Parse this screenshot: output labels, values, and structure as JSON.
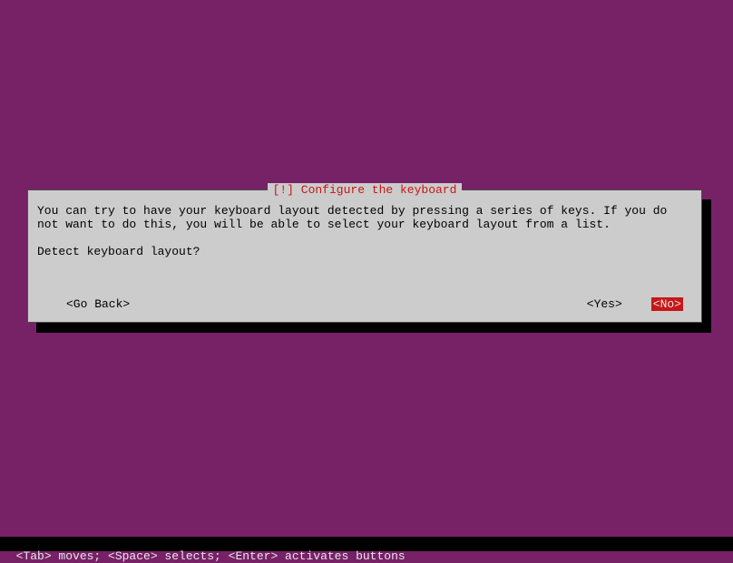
{
  "dialog": {
    "title": "[!] Configure the keyboard",
    "body": "You can try to have your keyboard layout detected by pressing a series of keys. If you do not want to do this, you will be able to select your keyboard layout from a list.",
    "prompt": "Detect keyboard layout?",
    "buttons": {
      "go_back": "<Go Back>",
      "yes": "<Yes>",
      "no": "<No>"
    }
  },
  "footer": {
    "hint": "<Tab> moves; <Space> selects; <Enter> activates buttons"
  }
}
